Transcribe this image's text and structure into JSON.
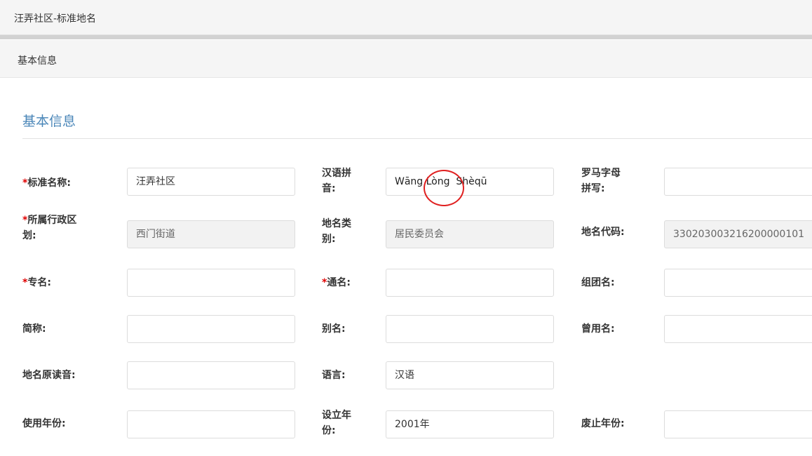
{
  "header": {
    "title": "汪弄社区-标准地名"
  },
  "panel": {
    "title": "基本信息"
  },
  "section": {
    "title": "基本信息"
  },
  "required_mark": "*",
  "fields": {
    "standard_name": {
      "label": "标准名称:",
      "value": "汪弄社区"
    },
    "pinyin": {
      "label_line1": "汉语拼",
      "label_line2": "音:",
      "value": "Wāng Lòng  Shèqū"
    },
    "roman": {
      "label_line1": "罗马字母",
      "label_line2": "拼写:",
      "value": ""
    },
    "admin_region": {
      "label_line1": "所属行政区",
      "label_line2": "划:",
      "value": "西门街道"
    },
    "place_type": {
      "label_line1": "地名类",
      "label_line2": "别:",
      "value": "居民委员会"
    },
    "place_code": {
      "label": "地名代码:",
      "value": "330203003216200000101"
    },
    "proper_name": {
      "label": "专名:",
      "value": ""
    },
    "generic_name": {
      "label": "通名:",
      "value": ""
    },
    "group_name": {
      "label": "组团名:",
      "value": ""
    },
    "abbreviation": {
      "label": "简称:",
      "value": ""
    },
    "alias": {
      "label": "别名:",
      "value": ""
    },
    "former_name": {
      "label": "曾用名:",
      "value": ""
    },
    "original_pronunciation": {
      "label": "地名原读音:",
      "value": ""
    },
    "language": {
      "label": "语言:",
      "value": "汉语"
    },
    "usage_year": {
      "label": "使用年份:",
      "value": ""
    },
    "established_year": {
      "label_line1": "设立年",
      "label_line2": "份:",
      "value": "2001年"
    },
    "abolished_year": {
      "label": "废止年份:",
      "value": ""
    }
  },
  "colors": {
    "section_title": "#4a86b8",
    "required": "#e00000",
    "annotation": "#e02020",
    "readonly_bg": "#f2f2f2"
  }
}
